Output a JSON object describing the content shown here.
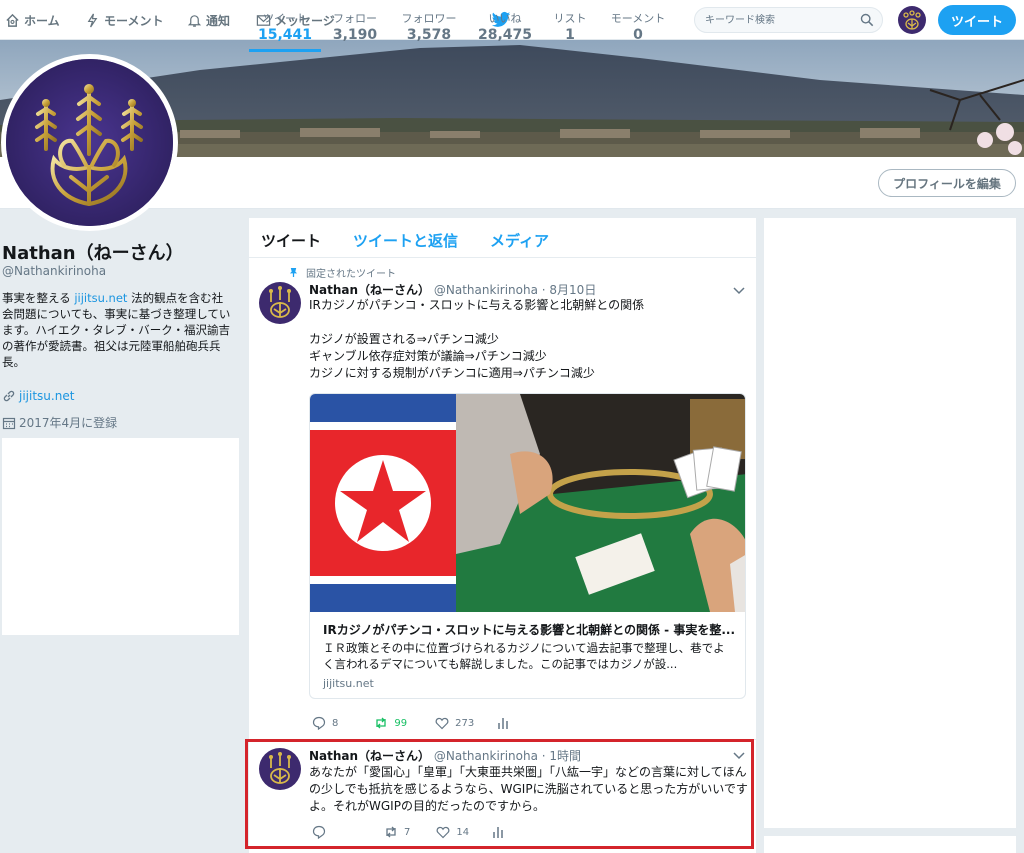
{
  "nav": {
    "home": "ホーム",
    "moments": "モーメント",
    "notifications": "通知",
    "messages": "メッセージ",
    "search_placeholder": "キーワード検索",
    "tweet_button": "ツイート"
  },
  "profile": {
    "name": "Nathan（ねーさん）",
    "handle": "@Nathankirinoha",
    "bio_prefix": "事実を整える ",
    "bio_link": "jijitsu.net",
    "bio_suffix": " 法的観点を含む社会問題についても、事実に基づき整理しています。ハイエク・タレブ・バーク・福沢諭吉の著作が愛読書。祖父は元陸軍船舶砲兵兵長。",
    "website": "jijitsu.net",
    "joined": "2017年4月に登録",
    "edit_button": "プロフィールを編集"
  },
  "stats": [
    {
      "label": "ツイート",
      "value": "15,441"
    },
    {
      "label": "フォロー",
      "value": "3,190"
    },
    {
      "label": "フォロワー",
      "value": "3,578"
    },
    {
      "label": "いいね",
      "value": "28,475"
    },
    {
      "label": "リスト",
      "value": "1"
    },
    {
      "label": "モーメント",
      "value": "0"
    }
  ],
  "tabs": [
    "ツイート",
    "ツイートと返信",
    "メディア"
  ],
  "pinned_label": "固定されたツイート",
  "tweets": [
    {
      "name": "Nathan（ねーさん）",
      "handle": "@Nathankirinoha",
      "time": "· 8月10日",
      "text": "IRカジノがパチンコ・スロットに与える影響と北朝鮮との関係\n\nカジノが設置される⇒パチンコ減少\nギャンブル依存症対策が議論⇒パチンコ減少\nカジノに対する規制がパチンコに適用⇒パチンコ減少",
      "card": {
        "title": "IRカジノがパチンコ・スロットに与える影響と北朝鮮との関係 - 事実を整...",
        "description": "ＩＲ政策とその中に位置づけられるカジノについて過去記事で整理し、巷でよく言われるデマについても解説しました。この記事ではカジノが設...",
        "domain": "jijitsu.net"
      },
      "replies": "8",
      "retweets": "99",
      "likes": "273"
    },
    {
      "name": "Nathan（ねーさん）",
      "handle": "@Nathankirinoha",
      "time": "· 1時間",
      "text": "あなたが「愛国心」「皇軍」「大東亜共栄圏」「八紘一宇」などの言葉に対してほんの少しでも抵抗を感じるようなら、WGIPに洗脳されていると思った方がいいですよ。それがWGIPの目的だったのですから。",
      "replies": "",
      "retweets": "7",
      "likes": "14"
    }
  ],
  "colors": {
    "accent": "#1da1f2",
    "highlight_border": "#d4242b",
    "retweet": "#17bf63"
  }
}
